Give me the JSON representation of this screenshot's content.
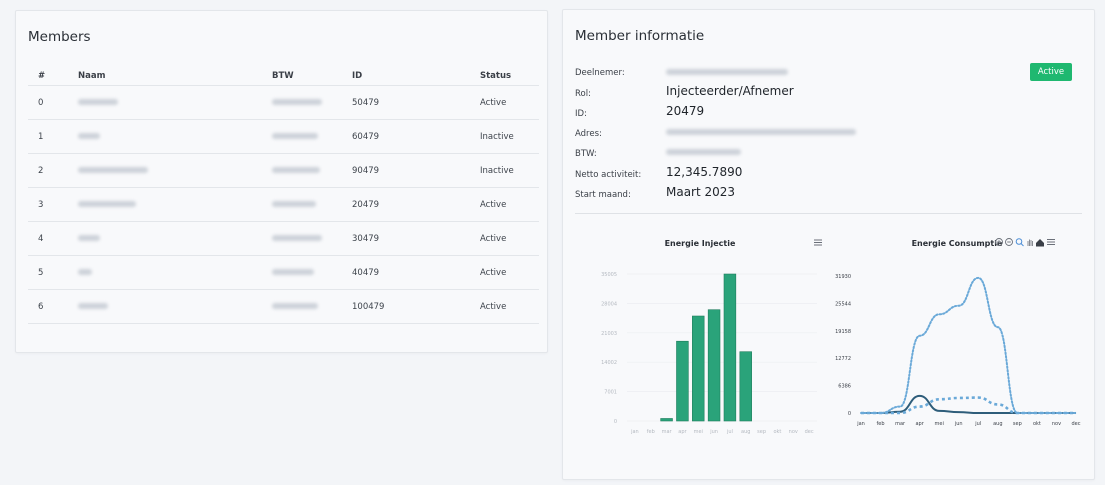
{
  "members": {
    "title": "Members",
    "columns": [
      "#",
      "Naam",
      "BTW",
      "ID",
      "Status"
    ],
    "rows": [
      {
        "num": "0",
        "id": "50479",
        "status": "Active"
      },
      {
        "num": "1",
        "id": "60479",
        "status": "Inactive"
      },
      {
        "num": "2",
        "id": "90479",
        "status": "Inactive"
      },
      {
        "num": "3",
        "id": "20479",
        "status": "Active"
      },
      {
        "num": "4",
        "id": "30479",
        "status": "Active"
      },
      {
        "num": "5",
        "id": "40479",
        "status": "Active"
      },
      {
        "num": "6",
        "id": "100479",
        "status": "Active"
      }
    ]
  },
  "info": {
    "title": "Member informatie",
    "badge": "Active",
    "labels": {
      "deelnemer": "Deelnemer:",
      "rol": "Rol:",
      "id": "ID:",
      "adres": "Adres:",
      "btw": "BTW:",
      "netto": "Netto activiteit:",
      "start": "Start maand:"
    },
    "values": {
      "rol": "Injecteerder/Afnemer",
      "id": "20479",
      "netto": "12,345.7890",
      "start": "Maart 2023"
    }
  },
  "colors": {
    "accent": "#1fb870",
    "active": "#1f9d55",
    "inactive": "#e0383e",
    "bar": "#2aa37a",
    "line_dark": "#2e5d7a",
    "line_light": "#6aa9d8"
  },
  "chart_data": [
    {
      "type": "bar",
      "title": "Energie Injectie",
      "categories": [
        "jan",
        "feb",
        "mar",
        "apr",
        "mei",
        "jun",
        "jul",
        "aug",
        "sep",
        "okt",
        "nov",
        "dec"
      ],
      "values": [
        0,
        0,
        600,
        19000,
        25000,
        26500,
        35000,
        16500,
        0,
        0,
        0,
        0
      ],
      "yticks": [
        "0",
        "7001",
        "14002",
        "21003",
        "28004",
        "35005"
      ],
      "ylim": [
        0,
        35005
      ]
    },
    {
      "type": "line",
      "title": "Energie Consumptie",
      "categories": [
        "jan",
        "feb",
        "mar",
        "apr",
        "mei",
        "jun",
        "jul",
        "aug",
        "sep",
        "okt",
        "nov",
        "dec"
      ],
      "yticks": [
        "0",
        "6386",
        "12772",
        "19158",
        "25544",
        "31930"
      ],
      "ylim": [
        0,
        31930
      ],
      "series": [
        {
          "values": [
            0,
            0,
            300,
            4000,
            500,
            200,
            0,
            0,
            0,
            0,
            0,
            0
          ],
          "style": "solid"
        },
        {
          "values": [
            0,
            0,
            0,
            1500,
            3200,
            3500,
            3600,
            2000,
            0,
            0,
            0,
            0
          ],
          "style": "dashed"
        },
        {
          "values": [
            0,
            0,
            1500,
            18000,
            23000,
            25000,
            31500,
            20000,
            0,
            0,
            0,
            0
          ],
          "style": "dotted"
        }
      ]
    }
  ]
}
